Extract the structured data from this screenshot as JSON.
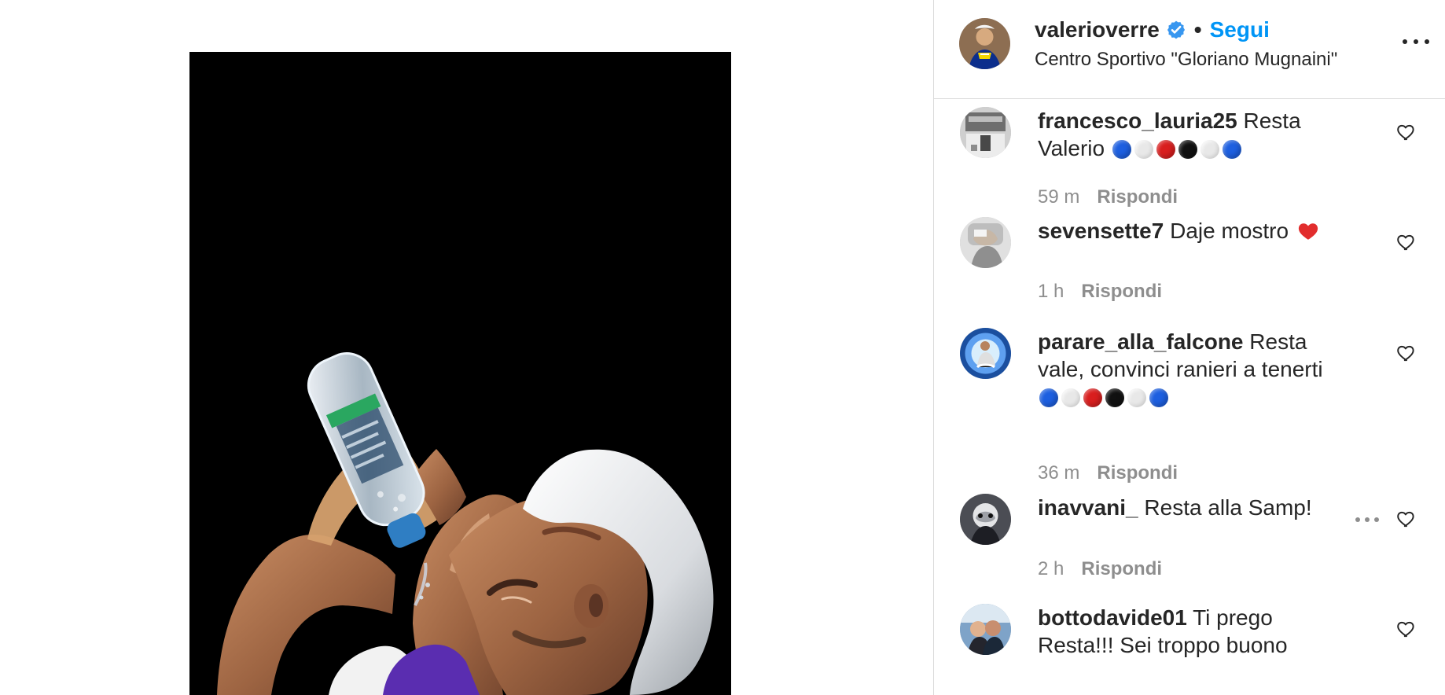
{
  "post": {
    "author": "valerioverre",
    "follow_label": "Segui",
    "location": "Centro Sportivo \"Gloriano Mugnaini\""
  },
  "comments": [
    {
      "username": "francesco_lauria25",
      "text": "Resta Valerio",
      "time": "59 m",
      "reply_label": "Rispondi"
    },
    {
      "username": "sevensette7",
      "text": "Daje mostro",
      "time": "1 h",
      "reply_label": "Rispondi"
    },
    {
      "username": "parare_alla_falcone",
      "text": "Resta vale, convinci ranieri a tenerti",
      "time": "36 m",
      "reply_label": "Rispondi"
    },
    {
      "username": "inavvani_",
      "text": "Resta alla Samp!",
      "time": "2 h",
      "reply_label": "Rispondi"
    },
    {
      "username": "bottodavide01",
      "text": "Ti prego Resta!!! Sei troppo buono",
      "time": "",
      "reply_label": ""
    }
  ],
  "colors": {
    "accent": "#0095f6",
    "muted": "#8e8e8e",
    "divider": "#dbdbdb"
  },
  "icons": {
    "verified": "verified-badge-icon",
    "heart": "heart-outline-icon",
    "more": "more-horizontal-icon"
  }
}
